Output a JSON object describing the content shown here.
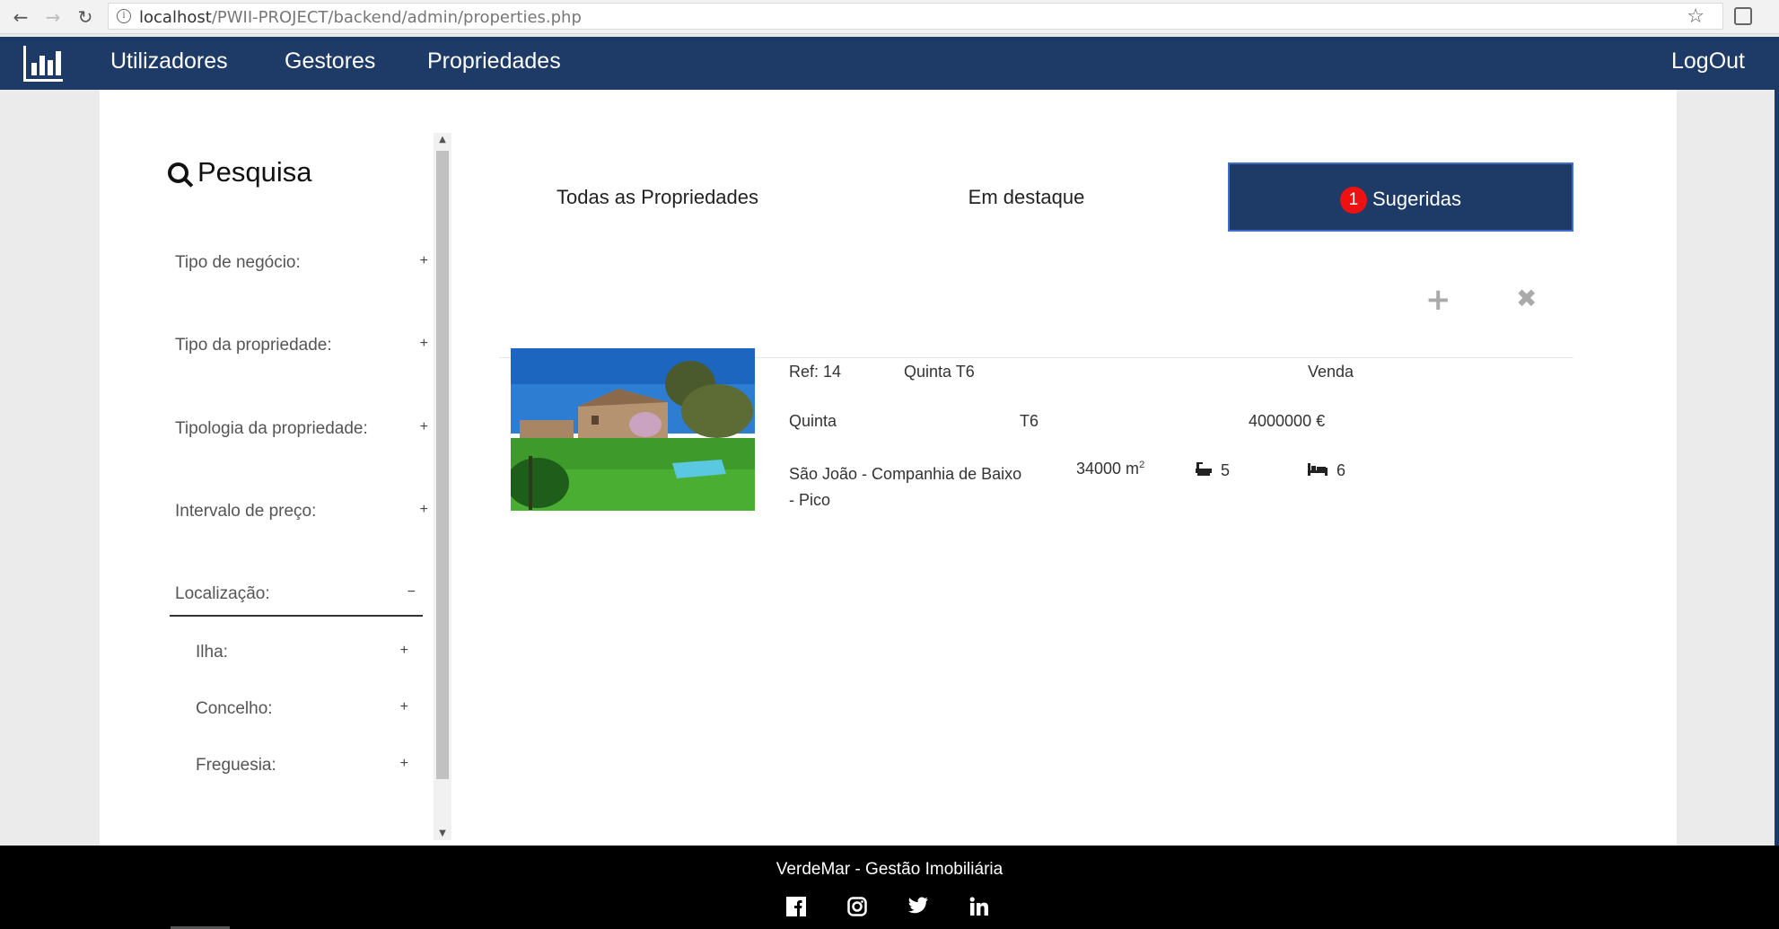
{
  "browser": {
    "url_host": "localhost",
    "url_path": "/PWII-PROJECT/backend/admin/properties.php"
  },
  "nav": {
    "items": [
      "Utilizadores",
      "Gestores",
      "Propriedades"
    ],
    "logout": "LogOut"
  },
  "sidebar": {
    "title": "Pesquisa",
    "filters": [
      {
        "label": "Tipo de negócio:",
        "sign": "+"
      },
      {
        "label": "Tipo da propriedade:",
        "sign": "+"
      },
      {
        "label": "Tipologia da propriedade:",
        "sign": "+"
      },
      {
        "label": "Intervalo de preço:",
        "sign": "+"
      },
      {
        "label": "Localização:",
        "sign": "−"
      }
    ],
    "subfilters": [
      {
        "label": "Ilha:",
        "sign": "+"
      },
      {
        "label": "Concelho:",
        "sign": "+"
      },
      {
        "label": "Freguesia:",
        "sign": "+"
      }
    ]
  },
  "tabs": {
    "all": "Todas as Propriedades",
    "featured": "Em destaque",
    "suggested": "Sugeridas",
    "suggested_count": "1"
  },
  "actions": {
    "add_icon": "plus-icon",
    "remove_icon": "close-icon"
  },
  "property": {
    "ref": "Ref: 14",
    "title": "Quinta T6",
    "business": "Venda",
    "type": "Quinta",
    "typology": "T6",
    "price": "4000000 €",
    "location_line1": "São João - Companhia de Baixo",
    "location_line2": "- Pico",
    "area": "34000 m",
    "area_unit_sup": "2",
    "bathrooms": "5",
    "bedrooms": "6"
  },
  "footer": {
    "brand": "VerdeMar - Gestão Imobiliária",
    "social": [
      "facebook-icon",
      "instagram-icon",
      "twitter-icon",
      "linkedin-icon"
    ]
  },
  "colors": {
    "nav_bg": "#1e3a66",
    "badge": "#ee1111",
    "footer_bg": "#000000"
  }
}
